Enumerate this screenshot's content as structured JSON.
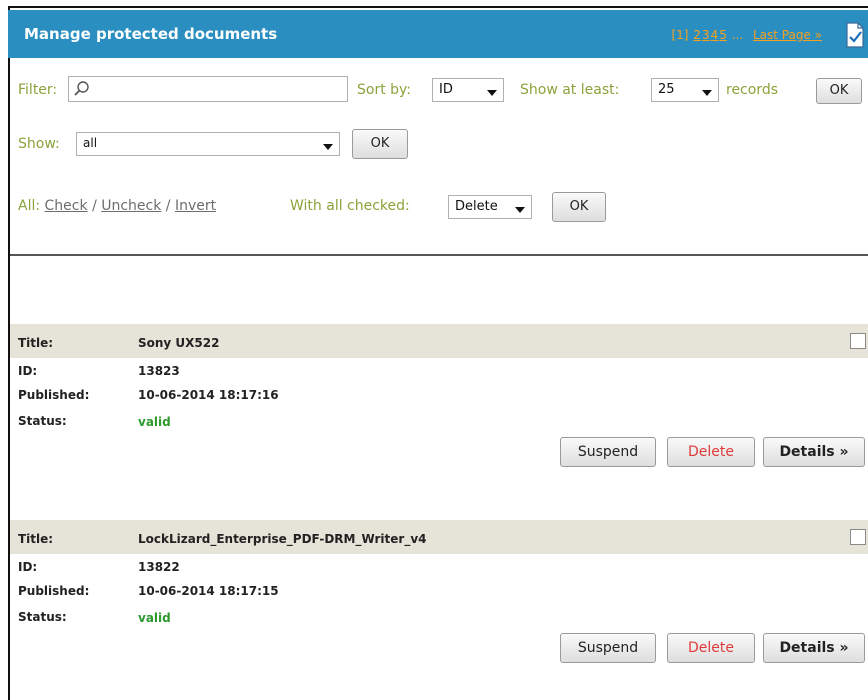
{
  "header": {
    "title": "Manage protected documents",
    "pager": {
      "current": "[1]",
      "pages": [
        "2",
        "3",
        "4",
        "5"
      ],
      "ellipsis": "...",
      "last": "Last Page »"
    }
  },
  "filters": {
    "filter_label": "Filter:",
    "filter_value": "",
    "sort_label": "Sort by:",
    "sort_value": "ID",
    "show_least_label": "Show at least:",
    "show_least_value": "25",
    "records_label": "records",
    "ok": "OK",
    "show_label": "Show:",
    "show_value": "all",
    "show_ok": "OK"
  },
  "bulk": {
    "all_label": "All:",
    "check": "Check",
    "uncheck": "Uncheck",
    "invert": "Invert",
    "sep": "/",
    "with_checked_label": "With all checked:",
    "action_value": "Delete",
    "ok": "OK"
  },
  "labels": {
    "title": "Title:",
    "id": "ID:",
    "published": "Published:",
    "status": "Status:"
  },
  "actions": {
    "suspend": "Suspend",
    "delete": "Delete",
    "details": "Details »"
  },
  "records": [
    {
      "title": "Sony UX522",
      "id": "13823",
      "published": "10-06-2014 18:17:16",
      "status": "valid"
    },
    {
      "title": "LockLizard_Enterprise_PDF-DRM_Writer_v4",
      "id": "13822",
      "published": "10-06-2014 18:17:15",
      "status": "valid"
    }
  ],
  "colors": {
    "header_bg": "#2a8fc0",
    "label_green": "#8aa33a",
    "status_green": "#2e9a2e",
    "delete_red": "#e03b3b",
    "row_head_bg": "#e6e3d8",
    "pager_orange": "#f5a020"
  }
}
